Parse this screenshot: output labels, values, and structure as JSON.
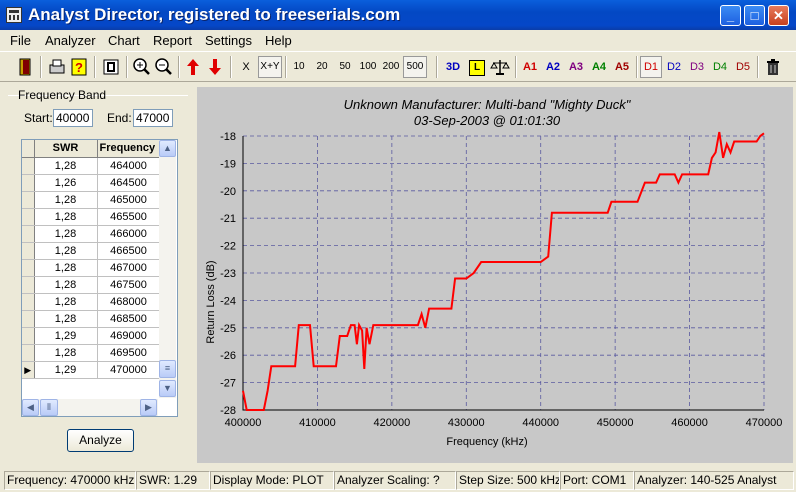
{
  "window": {
    "title": "Analyst Director, registered to freeserials.com"
  },
  "menu": [
    "File",
    "Analyzer",
    "Chart",
    "Report",
    "Settings",
    "Help"
  ],
  "toolbar": {
    "x_label": "X",
    "xy_label": "X+Y",
    "step_buttons": [
      "10",
      "20",
      "50",
      "100",
      "200",
      "500"
    ],
    "selected_step": "500",
    "view_3d": "3D",
    "view_l": "L",
    "a_buttons": [
      "A1",
      "A2",
      "A3",
      "A4",
      "A5"
    ],
    "a_colors": [
      "#d00000",
      "#0000c0",
      "#800080",
      "#008000",
      "#a00000"
    ],
    "d_buttons": [
      "D1",
      "D2",
      "D3",
      "D4",
      "D5"
    ],
    "d_colors": [
      "#d00000",
      "#0000c0",
      "#800080",
      "#008000",
      "#a00000"
    ],
    "icons": [
      "exit-door-icon",
      "print-icon",
      "help-icon",
      "stop-icon",
      "zoom-in-icon",
      "zoom-out-icon",
      "arrow-up-icon",
      "arrow-down-icon",
      "scale-icon",
      "trash-icon"
    ]
  },
  "frequency_band": {
    "label": "Frequency Band",
    "start_label": "Start:",
    "start_value": "40000",
    "end_label": "End:",
    "end_value": "47000"
  },
  "table": {
    "headers": [
      "SWR",
      "Frequency"
    ],
    "rows": [
      [
        "1,28",
        "464000"
      ],
      [
        "1,26",
        "464500"
      ],
      [
        "1,28",
        "465000"
      ],
      [
        "1,28",
        "465500"
      ],
      [
        "1,28",
        "466000"
      ],
      [
        "1,28",
        "466500"
      ],
      [
        "1,28",
        "467000"
      ],
      [
        "1,28",
        "467500"
      ],
      [
        "1,28",
        "468000"
      ],
      [
        "1,28",
        "468500"
      ],
      [
        "1,29",
        "469000"
      ],
      [
        "1,28",
        "469500"
      ],
      [
        "1,29",
        "470000"
      ]
    ],
    "current_row": 12
  },
  "analyze_button": "Analyze",
  "chart_data": {
    "type": "line",
    "title": "Unknown Manufacturer: Multi-band \"Mighty Duck\"",
    "subtitle": "03-Sep-2003 @ 01:01:30",
    "xlabel": "Frequency (kHz)",
    "ylabel": "Return Loss (dB)",
    "xlim": [
      400000,
      470000
    ],
    "ylim": [
      -28,
      -18
    ],
    "xticks": [
      "400000",
      "410000",
      "420000",
      "430000",
      "440000",
      "450000",
      "460000",
      "470000"
    ],
    "yticks": [
      "-18",
      "-19",
      "-20",
      "-21",
      "-22",
      "-23",
      "-24",
      "-25",
      "-26",
      "-27",
      "-28"
    ],
    "grid": true,
    "line_color": "#ff0000",
    "series": [
      {
        "x": [
          400000,
          400500,
          401000,
          402000,
          402800,
          403300,
          403800,
          407000,
          407500,
          408500,
          409000,
          409500,
          410500,
          412500,
          413000,
          414000,
          414500,
          415000,
          415300,
          415600,
          416000,
          416300,
          416600,
          417000,
          417500,
          418000,
          420000,
          422000,
          423500,
          424000,
          424500,
          425000,
          425500,
          426500,
          428000,
          428500,
          429000,
          430000,
          431000,
          432000,
          436000,
          440000,
          441000,
          441500,
          442000,
          446000,
          449000,
          449500,
          450000,
          453000,
          454000,
          454500,
          455500,
          456000,
          458000,
          458500,
          459000,
          459500,
          460000,
          462500,
          463000,
          463500,
          464000,
          464500,
          465000,
          465500,
          466000,
          467000,
          468000,
          469000,
          469500,
          470000
        ],
        "y": [
          -27.3,
          -28.3,
          -28.3,
          -28.3,
          -28.3,
          -27.3,
          -26.4,
          -26.4,
          -24.9,
          -24.9,
          -24.9,
          -26.4,
          -26.4,
          -26.4,
          -25.3,
          -25.3,
          -24.9,
          -24.9,
          -25.6,
          -24.9,
          -25.1,
          -26.5,
          -25.0,
          -25.6,
          -24.9,
          -24.9,
          -24.9,
          -24.9,
          -24.9,
          -24.5,
          -25.0,
          -24.3,
          -24.3,
          -24.3,
          -24.3,
          -23.2,
          -23.2,
          -23.2,
          -23.0,
          -22.6,
          -22.6,
          -22.6,
          -22.4,
          -20.8,
          -20.8,
          -20.8,
          -20.8,
          -20.4,
          -20.4,
          -20.4,
          -19.7,
          -19.7,
          -19.7,
          -19.4,
          -19.4,
          -19.7,
          -19.4,
          -19.4,
          -19.4,
          -19.4,
          -18.8,
          -18.6,
          -17.8,
          -18.8,
          -18.3,
          -18.6,
          -18.2,
          -18.2,
          -18.2,
          -18.2,
          -18.0,
          -17.9
        ]
      }
    ]
  },
  "status": [
    "Frequency: 470000 kHz",
    "SWR: 1.29",
    "Display Mode: PLOT",
    "Analyzer Scaling: ?",
    "Step Size: 500 kHz",
    "Port: COM1",
    "Analyzer: 140-525 Analyst"
  ]
}
